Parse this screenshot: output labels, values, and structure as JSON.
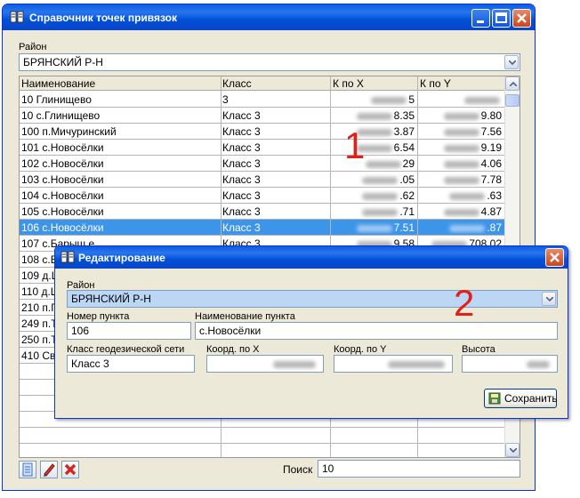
{
  "main_window": {
    "title": "Справочник точек привязок",
    "district_label": "Район",
    "district_value": "БРЯНСКИЙ Р-Н",
    "columns": [
      "Наименование",
      "Класс",
      "К по X",
      "К по Y"
    ],
    "rows": [
      {
        "name": "10 Глинищево",
        "cls": "3",
        "x": "5",
        "y": ""
      },
      {
        "name": "10 с.Глинищево",
        "cls": "Класс 3",
        "x": "8.35",
        "y": "9.80"
      },
      {
        "name": "100 п.Мичуринский",
        "cls": "Класс 3",
        "x": "3.87",
        "y": "7.56"
      },
      {
        "name": "101 с.Новосёлки",
        "cls": "Класс 3",
        "x": "6.54",
        "y": "9.19"
      },
      {
        "name": "102 с.Новосёлки",
        "cls": "Класс 3",
        "x": "29",
        "y": "4.06"
      },
      {
        "name": "103 с.Новосёлки",
        "cls": "Класс 3",
        "x": ".05",
        "y": "7.78"
      },
      {
        "name": "104 с.Новосёлки",
        "cls": "Класс 3",
        "x": ".62",
        "y": ".63"
      },
      {
        "name": "105 с.Новосёлки",
        "cls": "Класс 3",
        "x": ".71",
        "y": "4.87"
      },
      {
        "name": "106 с.Новосёлки",
        "cls": "Класс 3",
        "x": "7.51",
        "y": ".87"
      },
      {
        "name": "107 с.Барыш.е",
        "cls": "Класс 3",
        "x": "9.58",
        "y": "708.02"
      },
      {
        "name": "108 с.Б",
        "cls": "",
        "x": "",
        "y": ""
      },
      {
        "name": "109 д.Ш",
        "cls": "",
        "x": "",
        "y": ""
      },
      {
        "name": "110 д.Ш",
        "cls": "",
        "x": "",
        "y": ""
      },
      {
        "name": "210 п.Г",
        "cls": "",
        "x": "",
        "y": ""
      },
      {
        "name": "249 п.Т",
        "cls": "",
        "x": "",
        "y": ""
      },
      {
        "name": "250 п.Т",
        "cls": "",
        "x": "",
        "y": ""
      },
      {
        "name": "410 Св",
        "cls": "",
        "x": "",
        "y": ""
      }
    ],
    "selected_index": 8,
    "search_label": "Поиск",
    "search_value": "10"
  },
  "dialog": {
    "title": "Редактирование",
    "district_label": "Район",
    "district_value": "БРЯНСКИЙ Р-Н",
    "point_number_label": "Номер пункта",
    "point_number_value": "106",
    "point_name_label": "Наименование пункта",
    "point_name_value": "с.Новосёлки",
    "geo_class_label": "Класс геодезической сети",
    "geo_class_value": "Класс 3",
    "coord_x_label": "Коорд. по X",
    "coord_y_label": "Коорд. по Y",
    "height_label": "Высота",
    "save_label": "Сохранить"
  },
  "annotations": [
    "1",
    "2"
  ],
  "colors": {
    "title_blue": "#0a5fdf",
    "selection": "#3d95ea",
    "annotation_red": "#e0211a"
  }
}
